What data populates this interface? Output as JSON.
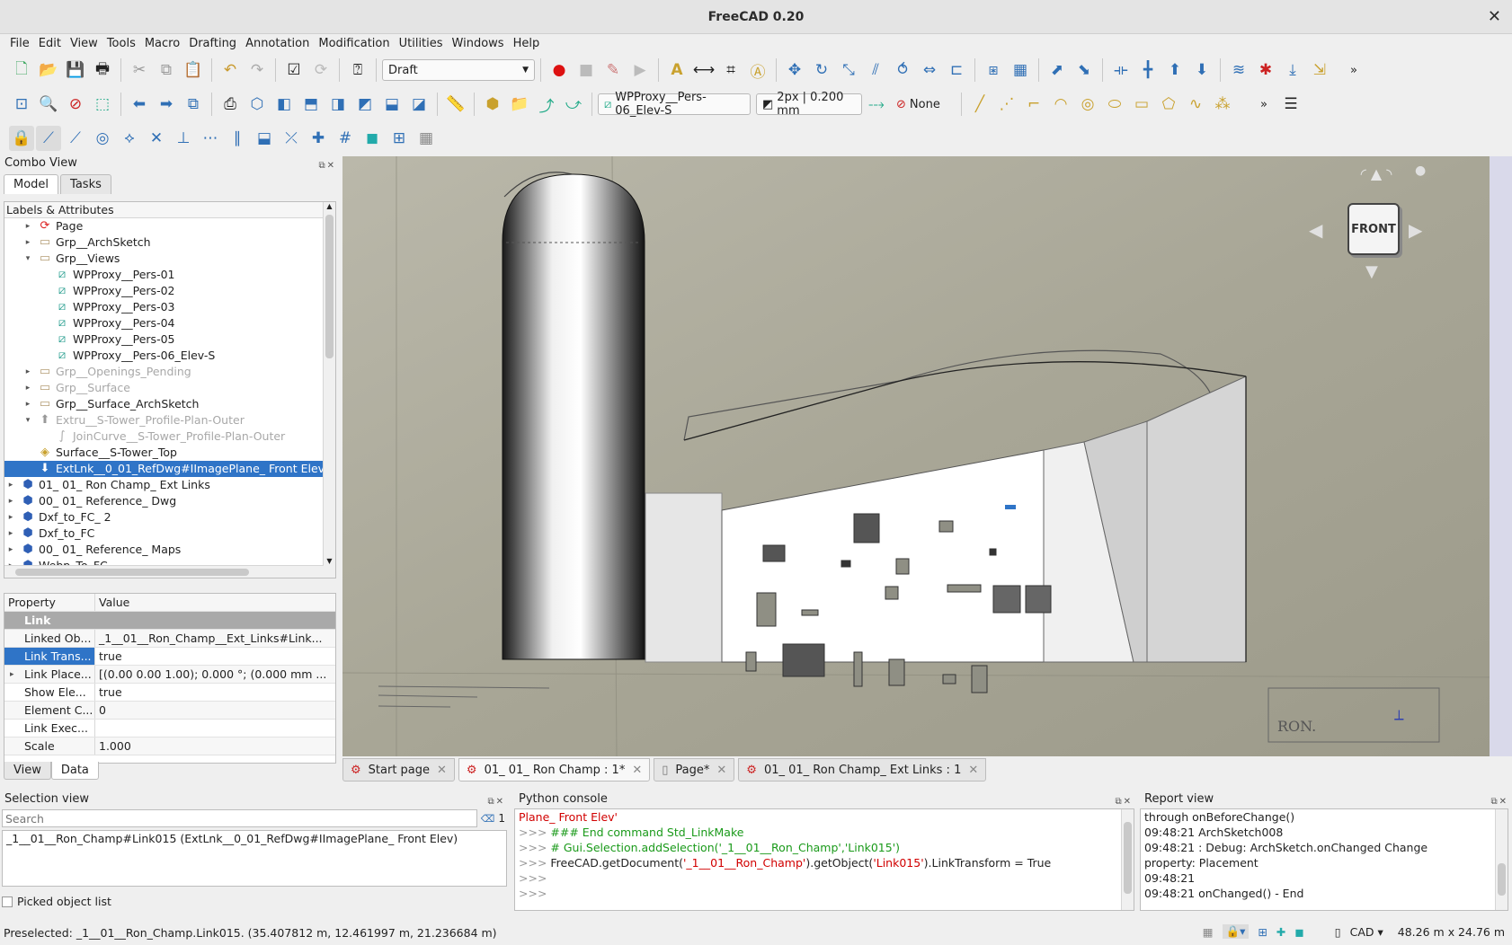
{
  "window": {
    "title": "FreeCAD 0.20",
    "close_glyph": "✕"
  },
  "menu": [
    "File",
    "Edit",
    "View",
    "Tools",
    "Macro",
    "Drafting",
    "Annotation",
    "Modification",
    "Utilities",
    "Windows",
    "Help"
  ],
  "toolbar": {
    "workbench": "Draft",
    "working_plane": "WPProxy__Pers-06_Elev-S",
    "line_style": "2px | 0.200 mm",
    "snap_none": "None",
    "more": "»"
  },
  "combo_view": {
    "title": "Combo View",
    "tabs": [
      "Model",
      "Tasks"
    ],
    "tree_header": "Labels & Attributes",
    "tree": [
      {
        "label": "Page",
        "depth": 1,
        "arrow": "▸",
        "icon": "page-icon",
        "dim": false
      },
      {
        "label": "Grp__ArchSketch",
        "depth": 1,
        "arrow": "▸",
        "icon": "folder-icon",
        "dim": false
      },
      {
        "label": "Grp__Views",
        "depth": 1,
        "arrow": "▾",
        "icon": "folder-icon",
        "dim": false
      },
      {
        "label": "WPProxy__Pers-01",
        "depth": 2,
        "arrow": "",
        "icon": "wpproxy-icon",
        "dim": false
      },
      {
        "label": "WPProxy__Pers-02",
        "depth": 2,
        "arrow": "",
        "icon": "wpproxy-icon",
        "dim": false
      },
      {
        "label": "WPProxy__Pers-03",
        "depth": 2,
        "arrow": "",
        "icon": "wpproxy-icon",
        "dim": false
      },
      {
        "label": "WPProxy__Pers-04",
        "depth": 2,
        "arrow": "",
        "icon": "wpproxy-icon",
        "dim": false
      },
      {
        "label": "WPProxy__Pers-05",
        "depth": 2,
        "arrow": "",
        "icon": "wpproxy-icon",
        "dim": false
      },
      {
        "label": "WPProxy__Pers-06_Elev-S",
        "depth": 2,
        "arrow": "",
        "icon": "wpproxy-icon",
        "dim": false
      },
      {
        "label": "Grp__Openings_Pending",
        "depth": 1,
        "arrow": "▸",
        "icon": "folder-icon",
        "dim": true
      },
      {
        "label": "Grp__Surface",
        "depth": 1,
        "arrow": "▸",
        "icon": "folder-icon",
        "dim": true
      },
      {
        "label": "Grp__Surface_ArchSketch",
        "depth": 1,
        "arrow": "▸",
        "icon": "folder-icon",
        "dim": false
      },
      {
        "label": "Extru__S-Tower_Profile-Plan-Outer",
        "depth": 1,
        "arrow": "▾",
        "icon": "extrude-icon",
        "dim": true
      },
      {
        "label": "JoinCurve__S-Tower_Profile-Plan-Outer",
        "depth": 2,
        "arrow": "",
        "icon": "curve-icon",
        "dim": true
      },
      {
        "label": "Surface__S-Tower_Top",
        "depth": 1,
        "arrow": "",
        "icon": "surface-icon",
        "dim": false
      },
      {
        "label": "ExtLnk__0_01_RefDwg#IImagePlane_ Front Elev",
        "depth": 1,
        "arrow": "",
        "icon": "link-icon",
        "dim": false,
        "selected": true
      },
      {
        "label": "01_ 01_ Ron Champ_ Ext Links",
        "depth": 0,
        "arrow": "▸",
        "icon": "document-icon",
        "dim": false
      },
      {
        "label": "00_ 01_ Reference_ Dwg",
        "depth": 0,
        "arrow": "▸",
        "icon": "document-icon",
        "dim": false
      },
      {
        "label": "Dxf_to_FC_ 2",
        "depth": 0,
        "arrow": "▸",
        "icon": "document-icon",
        "dim": false
      },
      {
        "label": "Dxf_to_FC",
        "depth": 0,
        "arrow": "▸",
        "icon": "document-icon",
        "dim": false
      },
      {
        "label": "00_ 01_ Reference_ Maps",
        "depth": 0,
        "arrow": "▸",
        "icon": "document-icon",
        "dim": false
      },
      {
        "label": "Webp_To_FC",
        "depth": 0,
        "arrow": "▸",
        "icon": "document-icon",
        "dim": false
      }
    ],
    "prop_header": {
      "name": "Property",
      "value": "Value"
    },
    "prop_group": "Link",
    "props": [
      {
        "name": "Linked Ob...",
        "value": "_1__01__Ron_Champ__Ext_Links#Link..."
      },
      {
        "name": "Link Trans...",
        "value": "true",
        "selected": true
      },
      {
        "name": "Link Place...",
        "value": "[(0.00 0.00 1.00); 0.000 °; (0.000 mm ...",
        "expand": true
      },
      {
        "name": "Show Ele...",
        "value": "true"
      },
      {
        "name": "Element C...",
        "value": "0"
      },
      {
        "name": "Link Exec...",
        "value": ""
      },
      {
        "name": "Scale",
        "value": "1.000"
      }
    ],
    "bottom_tabs": [
      "View",
      "Data"
    ]
  },
  "document_tabs": [
    {
      "label": "Start page",
      "active": false
    },
    {
      "label": "01_ 01_ Ron Champ : 1*",
      "active": true
    },
    {
      "label": "Page*",
      "active": false
    },
    {
      "label": "01_ 01_ Ron Champ_ Ext Links : 1",
      "active": false
    }
  ],
  "navcube": {
    "face": "FRONT"
  },
  "selection_view": {
    "title": "Selection view",
    "search_placeholder": "Search",
    "count": "1",
    "items": [
      "_1__01__Ron_Champ#Link015 (ExtLnk__0_01_RefDwg#IImagePlane_ Front Elev)"
    ],
    "picked_label": "Picked object list"
  },
  "python_console": {
    "title": "Python console",
    "lines": [
      {
        "prompt": "",
        "parts": [
          {
            "t": "Plane_ Front Elev'",
            "c": "red"
          }
        ]
      },
      {
        "prompt": ">>> ",
        "parts": [
          {
            "t": "### End command Std_LinkMake",
            "c": "green"
          }
        ]
      },
      {
        "prompt": ">>> ",
        "parts": [
          {
            "t": "# Gui.Selection.addSelection('_1__01__Ron_Champ','Link015')",
            "c": "green"
          }
        ]
      },
      {
        "prompt": ">>> ",
        "parts": [
          {
            "t": "FreeCAD.getDocument(",
            "c": ""
          },
          {
            "t": "'_1__01__Ron_Champ'",
            "c": "red"
          },
          {
            "t": ").getObject(",
            "c": ""
          },
          {
            "t": "'Link015'",
            "c": "red"
          },
          {
            "t": ").LinkTransform = True",
            "c": ""
          }
        ]
      },
      {
        "prompt": ">>> ",
        "parts": []
      },
      {
        "prompt": ">>> ",
        "parts": []
      }
    ]
  },
  "report_view": {
    "title": "Report view",
    "lines": [
      "through onBeforeChange()",
      "09:48:21  ArchSketch008",
      "09:48:21   : Debug: ArchSketch.onChanged Change",
      "property: Placement",
      "09:48:21",
      "09:48:21  onChanged() - End"
    ]
  },
  "status": {
    "preselected": "Preselected: _1__01__Ron_Champ.Link015. (35.407812 m, 12.461997 m, 21.236684 m)",
    "nav_style": "CAD",
    "dimensions": "48.26 m x 24.76 m"
  },
  "colors": {
    "selection": "#2f74c7",
    "viewport_bg": "#a9a798",
    "python_green": "#1a9a1a",
    "python_red": "#d10000"
  }
}
